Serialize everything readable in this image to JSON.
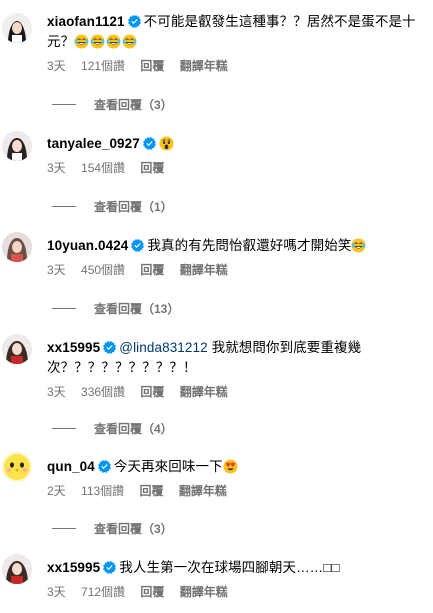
{
  "comments": [
    {
      "username": "xiaofan1121",
      "text": "不可能是叡發生這種事？？居然不是蛋不是十元？",
      "emojis": [
        "joy",
        "joy",
        "joy",
        "joy"
      ],
      "time": "3天",
      "likes": "121個讚",
      "reply_label": "回覆",
      "translate_label": "翻譯年糕",
      "view_replies": "查看回覆（3）"
    },
    {
      "username": "tanyalee_0927",
      "text": "",
      "emojis": [
        "astonished"
      ],
      "time": "3天",
      "likes": "154個讚",
      "reply_label": "回覆",
      "view_replies": "查看回覆（1）"
    },
    {
      "username": "10yuan.0424",
      "text": "我真的有先問怡叡還好嗎才開始笑",
      "emojis": [
        "joy"
      ],
      "time": "3天",
      "likes": "450個讚",
      "reply_label": "回覆",
      "translate_label": "翻譯年糕",
      "view_replies": "查看回覆（13）"
    },
    {
      "username": "xx15995",
      "mention": "@linda831212",
      "text": " 我就想問你到底要重複幾次？？？？？？？？？！",
      "time": "3天",
      "likes": "336個讚",
      "reply_label": "回覆",
      "translate_label": "翻譯年糕",
      "view_replies": "查看回覆（4）"
    },
    {
      "username": "qun_04",
      "text": "今天再來回味一下",
      "emojis": [
        "heart_eyes"
      ],
      "time": "2天",
      "likes": "113個讚",
      "reply_label": "回覆",
      "translate_label": "翻譯年糕",
      "view_replies": "查看回覆（3）"
    },
    {
      "username": "xx15995",
      "text": "我人生第一次在球場四腳朝天……□□",
      "time": "3天",
      "likes": "712個讚",
      "reply_label": "回覆",
      "translate_label": "翻譯年糕"
    }
  ],
  "colors": {
    "verified": "#0095f6",
    "meta": "#737373",
    "mention": "#00376b"
  }
}
